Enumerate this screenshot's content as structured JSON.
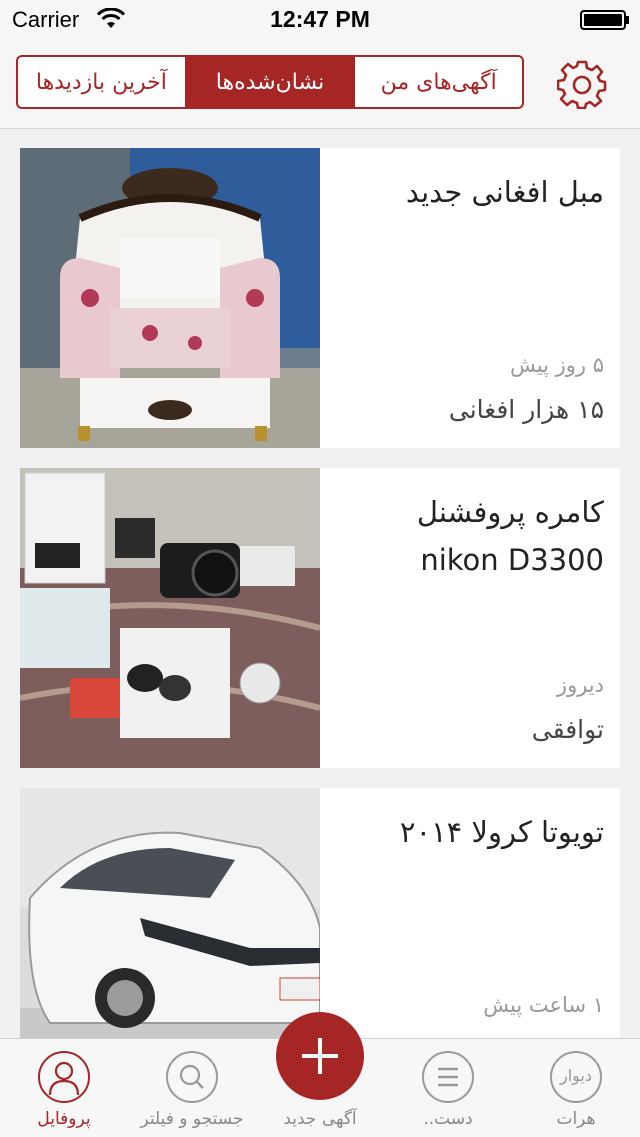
{
  "status_bar": {
    "carrier": "Carrier",
    "time": "12:47 PM"
  },
  "header": {
    "segments": [
      {
        "label": "آگهی‌های من",
        "active": false
      },
      {
        "label": "نشان‌شده‌ها",
        "active": true
      },
      {
        "label": "آخرین بازدیدها",
        "active": false
      }
    ]
  },
  "listings": [
    {
      "title": "مبل افغانی جدید",
      "time": "۵ روز پیش",
      "price": "۱۵ هزار افغانی",
      "image": "armchair"
    },
    {
      "title": "کامره پروفشنل nikon D3300",
      "time": "دیروز",
      "price": "توافقی",
      "image": "camera-kit"
    },
    {
      "title": "تویوتا کرولا ۲۰۱۴",
      "time": "۱ ساعت پیش",
      "price": "",
      "image": "white-car"
    }
  ],
  "tabbar": {
    "tabs": [
      {
        "label": "پروفایل",
        "icon": "person-icon",
        "active": true
      },
      {
        "label": "جستجو و فیلتر",
        "icon": "search-icon",
        "active": false
      },
      {
        "label": "آگهی جدید",
        "icon": "plus-icon",
        "active": false
      },
      {
        "label": "دست..",
        "icon": "list-icon",
        "active": false
      },
      {
        "label": "هرات",
        "icon": "divar-logo-icon",
        "active": false
      }
    ],
    "logo_text": "دیوار"
  },
  "colors": {
    "accent": "#a62626",
    "background": "#f1f1f1"
  }
}
